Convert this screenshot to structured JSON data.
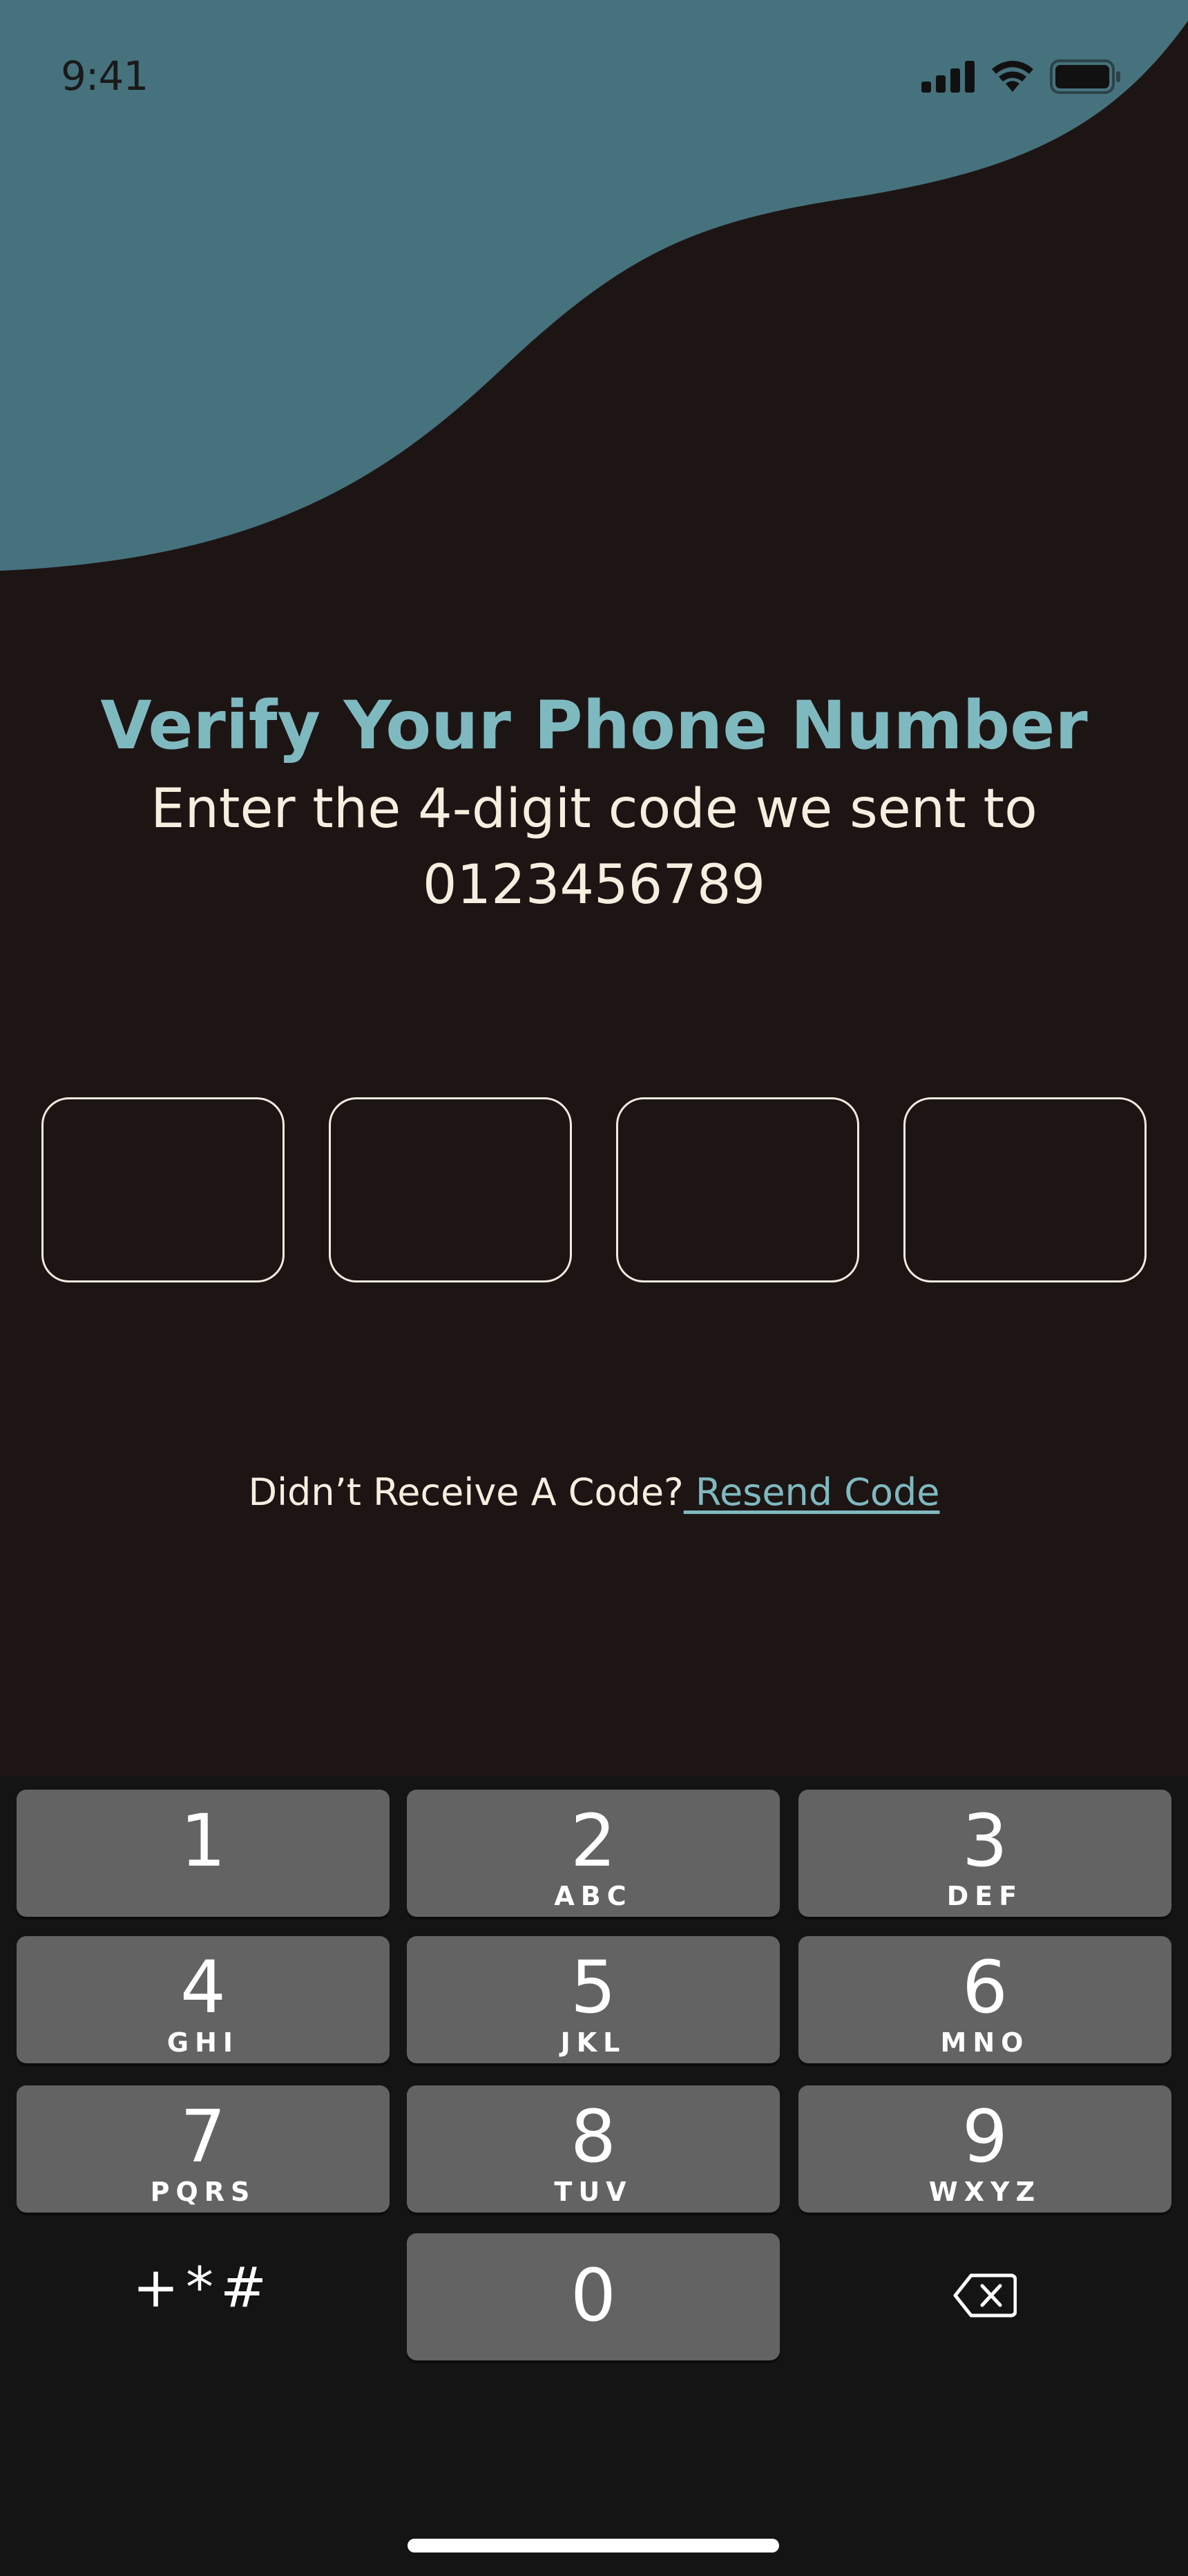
{
  "colors": {
    "background": "#1d1514",
    "wave": "#46727d",
    "accent": "#7fb9c0",
    "text": "#f5efe0",
    "key": "#636363",
    "keypad_bg": "#141414"
  },
  "status_bar": {
    "time": "9:41",
    "icons": [
      "signal-icon",
      "wifi-icon",
      "battery-icon"
    ]
  },
  "header": {
    "title": "Verify Your Phone Number",
    "subtitle": "Enter the 4-digit code we sent to",
    "phone": "0123456789"
  },
  "code_inputs": [
    "",
    "",
    "",
    ""
  ],
  "resend": {
    "prompt": "Didn’t Receive A Code?",
    "link": " Resend Code"
  },
  "keypad": {
    "keys": [
      {
        "digit": "1",
        "letters": ""
      },
      {
        "digit": "2",
        "letters": "ABC"
      },
      {
        "digit": "3",
        "letters": "DEF"
      },
      {
        "digit": "4",
        "letters": "GHI"
      },
      {
        "digit": "5",
        "letters": "JKL"
      },
      {
        "digit": "6",
        "letters": "MNO"
      },
      {
        "digit": "7",
        "letters": "PQRS"
      },
      {
        "digit": "8",
        "letters": "TUV"
      },
      {
        "digit": "9",
        "letters": "WXYZ"
      },
      {
        "digit": "0",
        "letters": ""
      }
    ],
    "symbols": "+*#",
    "delete_icon": "backspace-icon"
  }
}
